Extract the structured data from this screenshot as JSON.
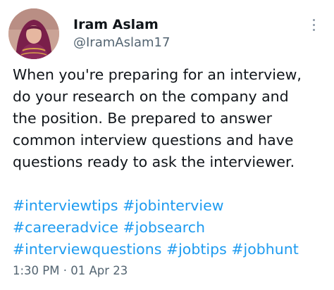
{
  "tweet": {
    "author": {
      "display_name": "Iram Aslam",
      "handle": "@IramAslam17",
      "avatar_icon": "profile-photo"
    },
    "more_icon": "vertical-ellipsis-icon",
    "text_lines": [
      "When you're preparing for an interview,",
      "do your research on the company and",
      "the position. Be prepared to answer",
      "common interview questions and have",
      "questions ready to ask the interviewer."
    ],
    "hashtag_lines": [
      [
        "#interviewtips",
        "#jobinterview"
      ],
      [
        "#careeradvice",
        "#jobsearch"
      ],
      [
        "#interviewquestions",
        "#jobtips",
        "#jobhunt"
      ]
    ],
    "time": "1:30 PM",
    "separator": "·",
    "date": "01 Apr 23"
  },
  "colors": {
    "text": "#0f1419",
    "secondary": "#536471",
    "link": "#1d9bf0",
    "background": "#ffffff"
  }
}
